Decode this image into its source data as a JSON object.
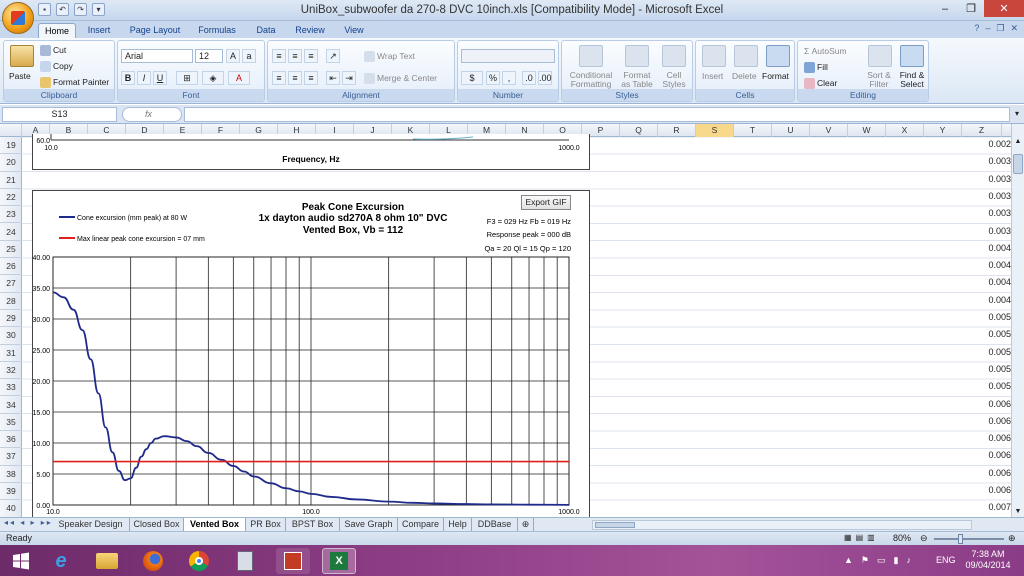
{
  "window": {
    "title": "UniBox_subwoofer da 270-8 DVC 10inch.xls  [Compatibility Mode]  -  Microsoft Excel"
  },
  "ribbon_tabs": [
    "Home",
    "Insert",
    "Page Layout",
    "Formulas",
    "Data",
    "Review",
    "View"
  ],
  "ribbon": {
    "clipboard": {
      "paste": "Paste",
      "cut": "Cut",
      "copy": "Copy",
      "format_painter": "Format Painter",
      "label": "Clipboard"
    },
    "font": {
      "name": "Arial",
      "size": "12",
      "label": "Font"
    },
    "alignment": {
      "wrap_text": "Wrap Text",
      "merge_center": "Merge & Center",
      "label": "Alignment"
    },
    "number": {
      "format": "",
      "label": "Number"
    },
    "styles": {
      "conditional": "Conditional Formatting",
      "format_table": "Format as Table",
      "cell_styles": "Cell Styles",
      "label": "Styles"
    },
    "cells": {
      "insert": "Insert",
      "delete": "Delete",
      "format": "Format",
      "label": "Cells"
    },
    "editing": {
      "autosum": "AutoSum",
      "fill": "Fill",
      "clear": "Clear",
      "sort_filter": "Sort & Filter",
      "find_select": "Find & Select",
      "label": "Editing"
    }
  },
  "formula_bar": {
    "name_box": "S13",
    "fx": "fx",
    "content": ""
  },
  "columns": [
    "A",
    "B",
    "C",
    "D",
    "E",
    "F",
    "G",
    "H",
    "I",
    "J",
    "K",
    "L",
    "M",
    "N",
    "O",
    "P",
    "Q",
    "R",
    "S",
    "T",
    "U",
    "V",
    "W",
    "X",
    "Y",
    "Z"
  ],
  "rows": [
    "19",
    "20",
    "21",
    "22",
    "23",
    "24",
    "25",
    "26",
    "27",
    "28",
    "29",
    "30",
    "31",
    "32",
    "33",
    "34",
    "35",
    "36",
    "37",
    "38",
    "39",
    "40"
  ],
  "column_z_values": [
    "0.002",
    "0.003",
    "0.003",
    "0.003",
    "0.003",
    "0.003",
    "0.004",
    "0.004",
    "0.004",
    "0.004",
    "0.005",
    "0.005",
    "0.005",
    "0.005",
    "0.005",
    "0.006",
    "0.006",
    "0.006",
    "0.006",
    "0.006",
    "0.006",
    "0.007"
  ],
  "top_chart": {
    "y_tick": "60.0",
    "x_ticks": [
      "10.0",
      "1000.0"
    ],
    "xlabel": "Frequency, Hz"
  },
  "chart_data": {
    "type": "line",
    "title": "Peak Cone Excursion",
    "subtitle_lines": [
      "1x dayton audio sd270A 8 ohm  10\" DVC",
      "Vented Box, Vb = 112"
    ],
    "x_scale": "log",
    "xlim": [
      10,
      1000
    ],
    "ylim": [
      0,
      40
    ],
    "x_tick_labels": [
      "10.0",
      "100.0",
      "1000.0"
    ],
    "y_tick_labels": [
      "40.00",
      "35.00",
      "30.00",
      "25.00",
      "20.00",
      "15.00",
      "10.00",
      "5.00",
      "0.00"
    ],
    "series": [
      {
        "name": "Cone excursion (mm peak) at 80 W",
        "color": "#1f2a8a",
        "x": [
          10,
          11,
          12,
          13,
          14,
          15,
          16,
          17,
          18,
          19,
          20,
          21,
          22,
          23,
          24,
          25,
          27,
          30,
          33,
          36,
          40,
          45,
          50,
          55,
          60,
          70,
          80,
          90,
          100,
          120,
          150,
          200,
          250,
          300,
          400,
          500,
          700,
          1000
        ],
        "values": [
          34.3,
          33.5,
          31.5,
          28.2,
          23.5,
          18.0,
          12.5,
          8.5,
          5.5,
          4.0,
          4.3,
          6.0,
          7.8,
          9.0,
          10.0,
          10.7,
          11.1,
          10.9,
          10.3,
          9.5,
          8.4,
          7.3,
          6.3,
          5.4,
          4.6,
          3.5,
          2.7,
          2.2,
          1.8,
          1.3,
          0.9,
          0.55,
          0.35,
          0.25,
          0.15,
          0.1,
          0.05,
          0.02
        ]
      },
      {
        "name": "Max linear peak cone excursion = 07 mm",
        "color": "#e0201c",
        "x": [
          10,
          1000
        ],
        "values": [
          7,
          7
        ]
      }
    ],
    "annotations": [
      "F3 = 029 Hz  Fb = 019 Hz",
      "Response peak = 000 dB",
      "Qa = 20  Ql = 15  Qp = 120"
    ],
    "button": "Export GIF"
  },
  "sheet_tabs": [
    "Speaker Design",
    "Closed Box",
    "Vented Box",
    "PR Box",
    "BPST Box",
    "Save Graph",
    "Compare",
    "Help",
    "DDBase"
  ],
  "active_sheet": "Vented Box",
  "status": {
    "ready": "Ready",
    "zoom": "80%"
  },
  "taskbar": {
    "lang": "ENG",
    "time": "7:38 AM",
    "date": "09/04/2014"
  }
}
